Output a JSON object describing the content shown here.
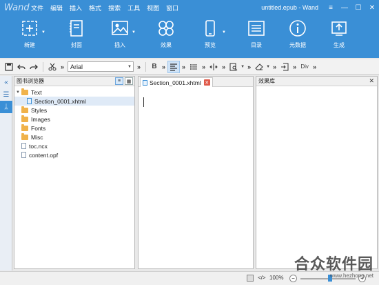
{
  "app": {
    "logo": "Wand",
    "window_title": "untitled.epub - Wand"
  },
  "menu": [
    "文件",
    "编辑",
    "插入",
    "格式",
    "搜索",
    "工具",
    "视图",
    "窗口"
  ],
  "ribbon": [
    {
      "label": "新建",
      "icon": "new-icon"
    },
    {
      "label": "封面",
      "icon": "cover-icon"
    },
    {
      "label": "插入",
      "icon": "image-icon"
    },
    {
      "label": "效果",
      "icon": "effects-icon"
    },
    {
      "label": "预览",
      "icon": "preview-icon"
    },
    {
      "label": "目录",
      "icon": "toc-icon"
    },
    {
      "label": "元数据",
      "icon": "info-icon"
    },
    {
      "label": "生成",
      "icon": "export-icon"
    }
  ],
  "toolbar": {
    "font_value": "Arial",
    "bold_label": "B",
    "more_label": "»",
    "div_label": "Div"
  },
  "browser": {
    "title": "图书浏览器",
    "tree": [
      {
        "label": "Text",
        "type": "folder",
        "expanded": true,
        "level": 0
      },
      {
        "label": "Section_0001.xhtml",
        "type": "file-xhtml",
        "level": 1
      },
      {
        "label": "Styles",
        "type": "folder",
        "level": 0
      },
      {
        "label": "Images",
        "type": "folder",
        "level": 0
      },
      {
        "label": "Fonts",
        "type": "folder",
        "level": 0
      },
      {
        "label": "Misc",
        "type": "folder",
        "level": 0
      },
      {
        "label": "toc.ncx",
        "type": "file",
        "level": 0
      },
      {
        "label": "content.opf",
        "type": "file",
        "level": 0
      }
    ]
  },
  "editor": {
    "tab_label": "Section_0001.xhtml"
  },
  "effects": {
    "title": "效果库"
  },
  "status": {
    "code_label": "</>",
    "zoom": "100%"
  },
  "watermark": {
    "title": "合众软件园",
    "url": "www.hezhong.net"
  },
  "colors": {
    "accent": "#3a8fd6",
    "folder": "#f0b24a",
    "close": "#e05a4a"
  }
}
